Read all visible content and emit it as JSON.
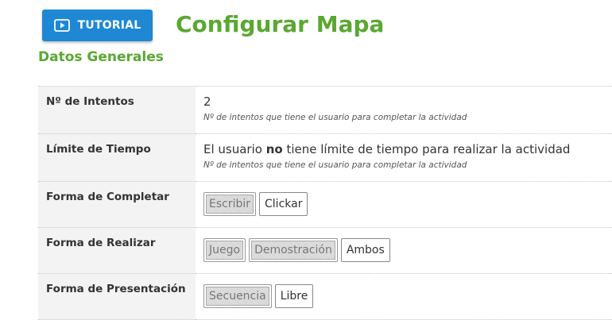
{
  "header": {
    "tutorial_label": "TUTORIAL",
    "title": "Configurar Mapa"
  },
  "section": {
    "title": "Datos Generales"
  },
  "rows": [
    {
      "label": "Nº de Intentos",
      "value": "2",
      "hint": "Nº de intentos que tiene el usuario para completar la actividad"
    },
    {
      "label": "Límite de Tiempo",
      "value_pre": "El usuario ",
      "value_bold": "no",
      "value_post": " tiene límite de tiempo para realizar la actividad",
      "hint": "Nº de intentos que tiene el usuario para completar la actividad"
    },
    {
      "label": "Forma de Completar",
      "options": [
        {
          "label": "Escribir",
          "selected": true
        },
        {
          "label": "Clickar",
          "selected": false
        }
      ]
    },
    {
      "label": "Forma de Realizar",
      "options": [
        {
          "label": "Juego",
          "selected": true
        },
        {
          "label": "Demostración",
          "selected": true
        },
        {
          "label": "Ambos",
          "selected": false
        }
      ]
    },
    {
      "label": "Forma de Presentación",
      "options": [
        {
          "label": "Secuencia",
          "selected": true
        },
        {
          "label": "Libre",
          "selected": false
        }
      ]
    }
  ],
  "colors": {
    "accent_green": "#5aa832",
    "button_blue": "#1e88d4"
  },
  "icons": {
    "tutorial": "play-icon"
  }
}
